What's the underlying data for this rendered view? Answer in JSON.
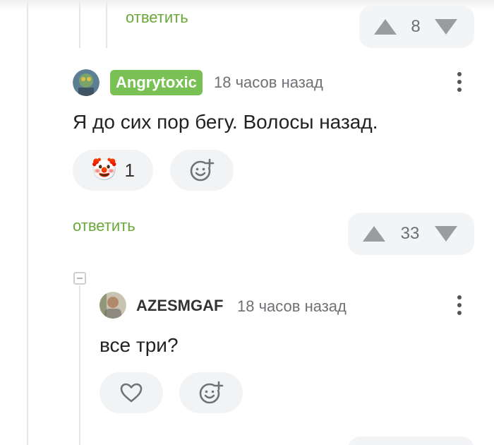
{
  "thread": {
    "top_reply": {
      "reply_label": "ответить",
      "votes": "8"
    },
    "comment1": {
      "username": "Angrytoxic",
      "time": "18 часов назад",
      "text": "Я до сих пор бегу. Волосы назад.",
      "reaction_emoji": "🤡",
      "reaction_count": "1",
      "reply_label": "ответить",
      "votes": "33"
    },
    "comment2": {
      "username": "AZESMGAF",
      "time": "18 часов назад",
      "text": "все три?"
    }
  },
  "icons": {
    "upvote": "triangle-up-icon",
    "downvote": "triangle-down-icon",
    "more": "vertical-dots-icon",
    "add_reaction": "smiley-plus-icon",
    "like": "heart-icon",
    "collapse": "minus-box-icon"
  },
  "colors": {
    "accent_green": "#6aa83a",
    "badge_green": "#79c154",
    "pill_bg": "#f2f3f5",
    "vote_gray": "#9a9ca0"
  }
}
